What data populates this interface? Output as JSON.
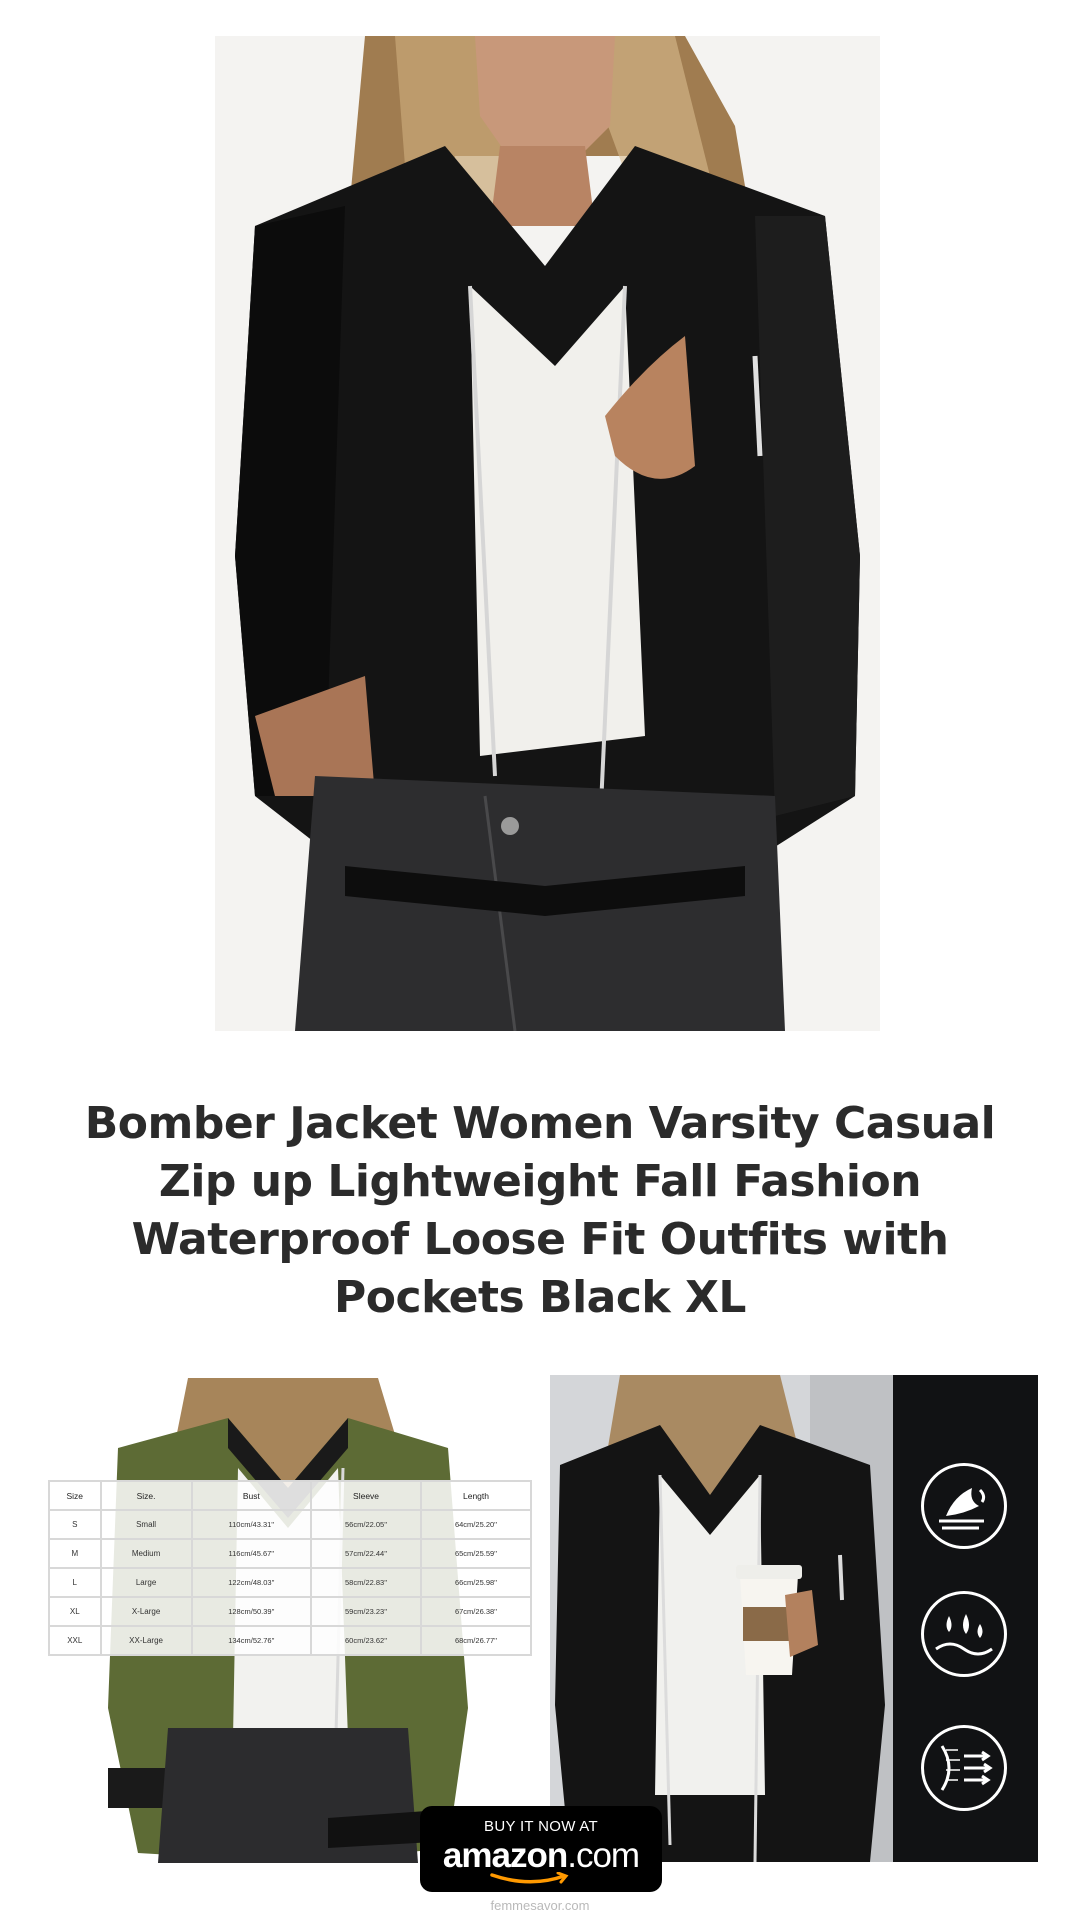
{
  "product": {
    "title": "Bomber Jacket Women Varsity Casual Zip up Lightweight Fall Fashion Waterproof Loose Fit Outfits with Pockets Black XL"
  },
  "size_chart": {
    "headers": [
      "Size",
      "Size.",
      "Bust",
      "Sleeve",
      "Length"
    ],
    "rows": [
      [
        "S",
        "Small",
        "110cm/43.31''",
        "56cm/22.05''",
        "64cm/25.20''"
      ],
      [
        "M",
        "Medium",
        "116cm/45.67''",
        "57cm/22.44''",
        "65cm/25.59''"
      ],
      [
        "L",
        "Large",
        "122cm/48.03''",
        "58cm/22.83''",
        "66cm/25.98''"
      ],
      [
        "XL",
        "X-Large",
        "128cm/50.39''",
        "59cm/23.23''",
        "67cm/26.38''"
      ],
      [
        "XXL",
        "XX-Large",
        "134cm/52.76''",
        "60cm/23.62''",
        "68cm/26.77''"
      ]
    ]
  },
  "features": [
    "windproof-icon",
    "waterproof-icon",
    "breathable-icon"
  ],
  "cta": {
    "buy_label": "BUY IT NOW AT",
    "brand_name": "amazon",
    "brand_tld": ".com"
  },
  "footer": {
    "site": "femmesavor.com"
  },
  "colors": {
    "jacket_black": "#141414",
    "jacket_olive": "#5d6b35",
    "title_text": "#2b2b2b",
    "amazon_orange": "#ff9900"
  }
}
